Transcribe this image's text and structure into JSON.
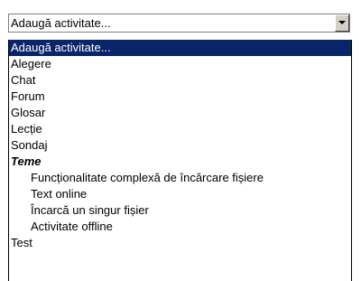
{
  "select": {
    "current_value": "Adaugă activitate..."
  },
  "options": {
    "o0": "Adaugă activitate...",
    "o1": "Alegere",
    "o2": "Chat",
    "o3": "Forum",
    "o4": "Glosar",
    "o5": "Lecție",
    "o6": "Sondaj",
    "group_teme": "Teme",
    "teme_1": "Funcționalitate complexă de încărcare fișiere",
    "teme_2": "Text online",
    "teme_3": "Încarcă un singur fișier",
    "teme_4": "Activitate offline",
    "o7": "Test"
  },
  "colors": {
    "highlight": "#0a246a",
    "highlight_text": "#ffffff"
  },
  "icons": {
    "dropdown": "chevron-down-icon"
  }
}
